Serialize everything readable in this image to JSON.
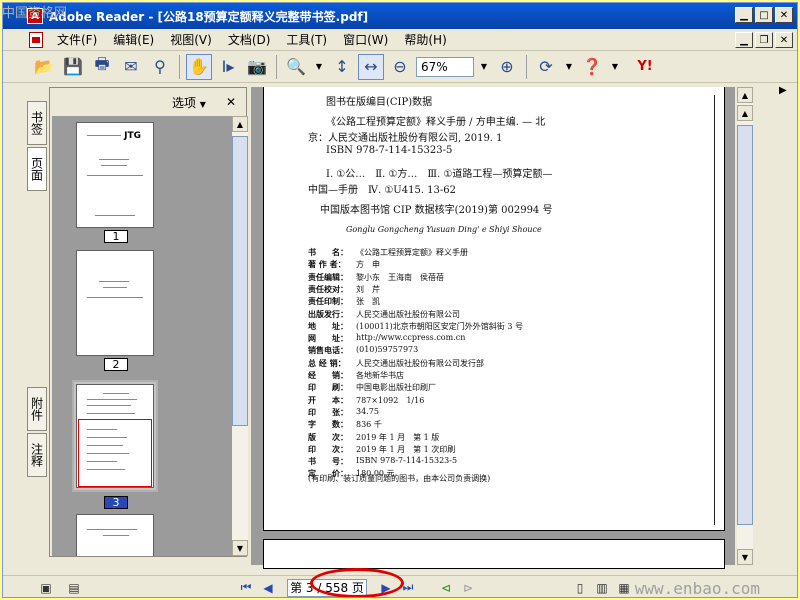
{
  "watermark_top": "中国资格网",
  "watermark_bottom": "www.enbao.com",
  "window": {
    "title": "Adobe Reader - [公路18预算定额释义完整带书签.pdf]",
    "app_icon_letter": "A"
  },
  "menu": {
    "items": [
      "文件(F)",
      "编辑(E)",
      "视图(V)",
      "文档(D)",
      "工具(T)",
      "窗口(W)",
      "帮助(H)"
    ]
  },
  "toolbar": {
    "zoom_value": "67%"
  },
  "left_tabs": [
    "书签",
    "页面",
    "附件",
    "注释"
  ],
  "sidebar": {
    "options_label": "选项",
    "close_glyph": "✕",
    "thumb_title": "JTG",
    "thumb_labels": [
      "1",
      "2",
      "3"
    ]
  },
  "page": {
    "cip_title": "图书在版编目(CIP)数据",
    "cip_line1": "《公路工程预算定额》释义手册 / 方申主编. — 北",
    "cip_line2": "京：人民交通出版社股份有限公司, 2019. 1",
    "cip_isbn": "ISBN 978-7-114-15323-5",
    "cip_class1": "Ⅰ. ①公…　Ⅱ. ①方…　Ⅲ. ①道路工程—预算定额—",
    "cip_class2": "中国—手册　Ⅳ. ①U415. 13-62",
    "cip_number": "中国版本图书馆 CIP 数据核字(2019)第 002994 号",
    "pinyin": "Gonglu Gongcheng Yusuan Ding' e Shiyi Shouce",
    "rows": [
      {
        "k": "书　　名：",
        "v": "《公路工程预算定额》释义手册"
      },
      {
        "k": "著 作 者：",
        "v": "方　申"
      },
      {
        "k": "责任编辑：",
        "v": "黎小东　王海南　侯蓓蓓"
      },
      {
        "k": "责任校对：",
        "v": "刘　芹"
      },
      {
        "k": "责任印制：",
        "v": "张　凯"
      },
      {
        "k": "出版发行：",
        "v": "人民交通出版社股份有限公司"
      },
      {
        "k": "地　　址：",
        "v": "(100011)北京市朝阳区安定门外外馆斜街 3 号"
      },
      {
        "k": "网　　址：",
        "v": "http://www.ccpress.com.cn"
      },
      {
        "k": "销售电话：",
        "v": "(010)59757973"
      },
      {
        "k": "总 经 销：",
        "v": "人民交通出版社股份有限公司发行部"
      },
      {
        "k": "经　　销：",
        "v": "各地新华书店"
      },
      {
        "k": "印　　刷：",
        "v": "中国电影出版社印刷厂"
      },
      {
        "k": "开　　本：",
        "v": "787×1092　1/16"
      },
      {
        "k": "印　　张：",
        "v": "34.75"
      },
      {
        "k": "字　　数：",
        "v": "836 千"
      },
      {
        "k": "版　　次：",
        "v": "2019 年 1 月　第 1 版"
      },
      {
        "k": "印　　次：",
        "v": "2019 年 1 月　第 1 次印刷"
      },
      {
        "k": "书　　号：",
        "v": "ISBN 978-7-114-15323-5"
      },
      {
        "k": "定　　价：",
        "v": "180.00 元"
      }
    ],
    "footnote": "(有印刷、装订质量问题的图书，由本公司负责调换)"
  },
  "status": {
    "page_indicator": "第 3 / 558 页"
  }
}
